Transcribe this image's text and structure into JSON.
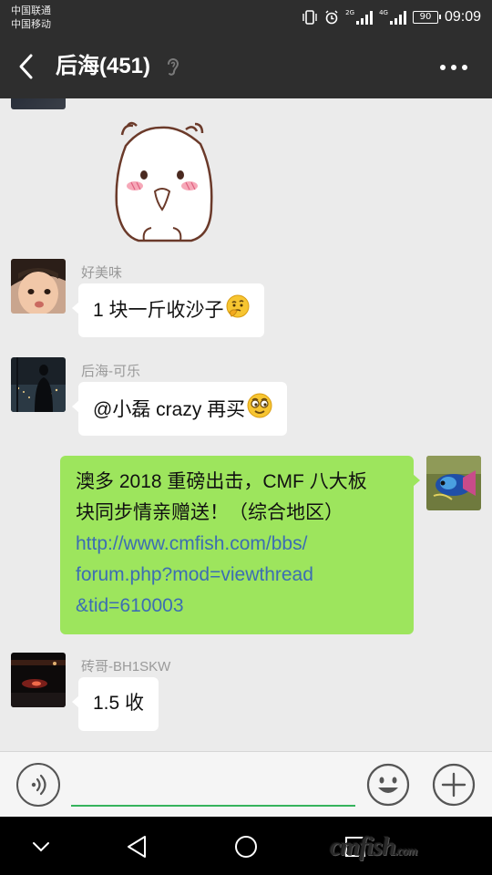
{
  "status_bar": {
    "carriers": [
      "中国联通",
      "中国移动"
    ],
    "network_1": "2G",
    "network_2": "4G",
    "battery": "90",
    "time": "09:09"
  },
  "header": {
    "title": "后海(451)"
  },
  "messages": [
    {
      "sender": "好美味",
      "text": "1 块一斤收沙子",
      "emoji": "thinking-face"
    },
    {
      "sender": "后海-可乐",
      "text": "@小磊 crazy  再买",
      "emoji": "smirking-face"
    },
    {
      "sender": "me",
      "text_lines": [
        "澳多 2018 重磅出击，CMF 八大板",
        "块同步情亲赠送！（综合地区）"
      ],
      "link_lines": [
        "http://www.cmfish.com/bbs/",
        "forum.php?mod=viewthread",
        "&tid=610003"
      ]
    },
    {
      "sender": "砖哥-BH1SKW",
      "text": "1.5 收"
    }
  ],
  "input": {
    "value": "",
    "placeholder": ""
  },
  "watermark": {
    "main": "cmfish",
    "suffix": ".com"
  },
  "colors": {
    "header_bg": "#2e2e2e",
    "chat_bg": "#ebebeb",
    "own_bubble": "#9de55d",
    "link": "#3c6db3",
    "input_underline": "#35b35c"
  }
}
